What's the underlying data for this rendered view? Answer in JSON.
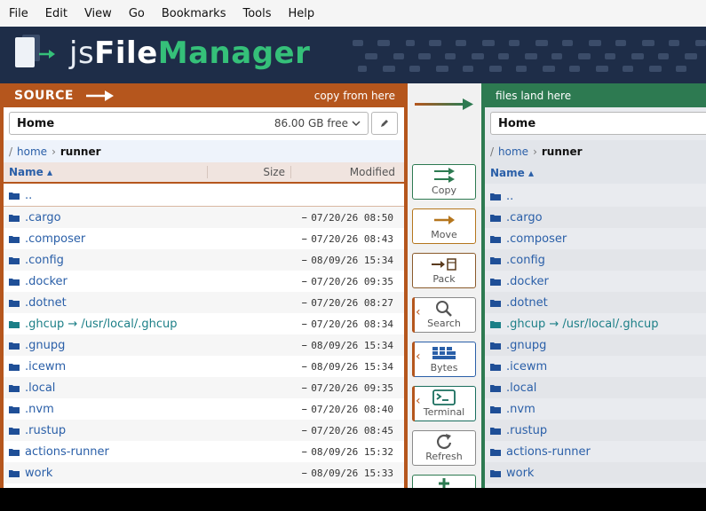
{
  "menu": [
    "File",
    "Edit",
    "View",
    "Go",
    "Bookmarks",
    "Tools",
    "Help"
  ],
  "brand": {
    "js": "js",
    "file": "File",
    "manager": "Manager"
  },
  "colors": {
    "source": "#b5561d",
    "dest": "#2d7a51",
    "banner": "#1e2d48",
    "link": "#2a5fa8",
    "symlink": "#1c7f87"
  },
  "source": {
    "title": "SOURCE",
    "subtitle": "copy from here",
    "location": "Home",
    "free": "86.00 GB free",
    "edit_icon": "pencil-icon",
    "breadcrumb_root": "/",
    "breadcrumb": [
      "home",
      "runner"
    ],
    "columns": {
      "name": "Name ▴",
      "size": "Size",
      "modified": "Modified"
    },
    "parent": "..",
    "rows": [
      {
        "name": ".cargo",
        "size": "–",
        "modified": "07/20/26 08:50",
        "link": false
      },
      {
        "name": ".composer",
        "size": "–",
        "modified": "07/20/26 08:43",
        "link": false
      },
      {
        "name": ".config",
        "size": "–",
        "modified": "08/09/26 15:34",
        "link": false
      },
      {
        "name": ".docker",
        "size": "–",
        "modified": "07/20/26 09:35",
        "link": false
      },
      {
        "name": ".dotnet",
        "size": "–",
        "modified": "07/20/26 08:27",
        "link": false
      },
      {
        "name": ".ghcup → /usr/local/.ghcup",
        "size": "–",
        "modified": "07/20/26 08:34",
        "link": true
      },
      {
        "name": ".gnupg",
        "size": "–",
        "modified": "08/09/26 15:34",
        "link": false
      },
      {
        "name": ".icewm",
        "size": "–",
        "modified": "08/09/26 15:34",
        "link": false
      },
      {
        "name": ".local",
        "size": "–",
        "modified": "07/20/26 09:35",
        "link": false
      },
      {
        "name": ".nvm",
        "size": "–",
        "modified": "07/20/26 08:40",
        "link": false
      },
      {
        "name": ".rustup",
        "size": "–",
        "modified": "07/20/26 08:45",
        "link": false
      },
      {
        "name": "actions-runner",
        "size": "–",
        "modified": "08/09/26 15:32",
        "link": false
      },
      {
        "name": "work",
        "size": "–",
        "modified": "08/09/26 15:33",
        "link": false
      }
    ]
  },
  "tools": [
    {
      "label": "Copy",
      "icon": "copy-arrows-icon"
    },
    {
      "label": "Move",
      "icon": "move-arrow-icon"
    },
    {
      "label": "Pack",
      "icon": "pack-icon"
    },
    {
      "label": "Search",
      "icon": "search-icon"
    },
    {
      "label": "Bytes",
      "icon": "bytes-icon"
    },
    {
      "label": "Terminal",
      "icon": "terminal-icon"
    },
    {
      "label": "Refresh",
      "icon": "refresh-icon"
    },
    {
      "label": "",
      "icon": "plus-icon"
    }
  ],
  "dest": {
    "subtitle": "files land here",
    "location": "Home",
    "breadcrumb_root": "/",
    "breadcrumb": [
      "home",
      "runner"
    ],
    "columns": {
      "name": "Name ▴"
    },
    "parent": "..",
    "rows": [
      {
        "name": ".cargo",
        "link": false
      },
      {
        "name": ".composer",
        "link": false
      },
      {
        "name": ".config",
        "link": false
      },
      {
        "name": ".docker",
        "link": false
      },
      {
        "name": ".dotnet",
        "link": false
      },
      {
        "name": ".ghcup → /usr/local/.ghcup",
        "link": true
      },
      {
        "name": ".gnupg",
        "link": false
      },
      {
        "name": ".icewm",
        "link": false
      },
      {
        "name": ".local",
        "link": false
      },
      {
        "name": ".nvm",
        "link": false
      },
      {
        "name": ".rustup",
        "link": false
      },
      {
        "name": "actions-runner",
        "link": false
      },
      {
        "name": "work",
        "link": false
      }
    ]
  }
}
